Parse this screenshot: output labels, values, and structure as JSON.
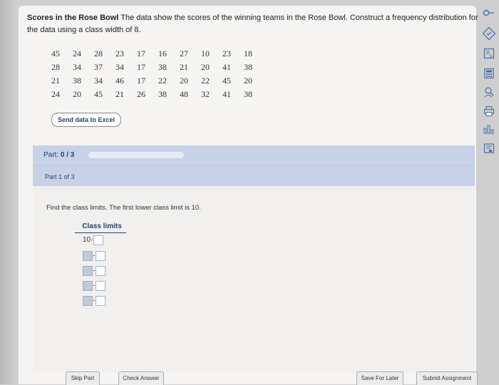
{
  "problem": {
    "title_bold": "Scores in the Rose Bowl",
    "title_rest": " The data show the scores of the winning teams in the Rose Bowl. Construct a frequency distribution for the data using a class width of 8."
  },
  "data_table": [
    [
      "45",
      "24",
      "28",
      "23",
      "17",
      "16",
      "27",
      "10",
      "23",
      "18"
    ],
    [
      "28",
      "34",
      "37",
      "34",
      "17",
      "38",
      "21",
      "20",
      "41",
      "38"
    ],
    [
      "21",
      "38",
      "34",
      "46",
      "17",
      "22",
      "20",
      "22",
      "45",
      "20"
    ],
    [
      "24",
      "20",
      "45",
      "21",
      "26",
      "38",
      "48",
      "32",
      "41",
      "38"
    ]
  ],
  "excel_button": "Send data to Excel",
  "part_progress": {
    "label": "Part:",
    "value": "0 / 3",
    "fraction": 0
  },
  "part1": {
    "label": "Part 1 of 3",
    "instruction": "Find the class limits. The first lower class limit is 10.",
    "class_header": "Class limits",
    "first_lower": "10"
  },
  "bottom": {
    "skip": "Skip Part",
    "check": "Check Answer",
    "save": "Save For Later",
    "submit": "Submit Assignment"
  },
  "sidebar_icons": [
    "key-icon",
    "checkmark-icon",
    "export-icon",
    "calculator-icon",
    "search-person-icon",
    "printer-icon",
    "chart-icon",
    "tutorial-icon"
  ]
}
